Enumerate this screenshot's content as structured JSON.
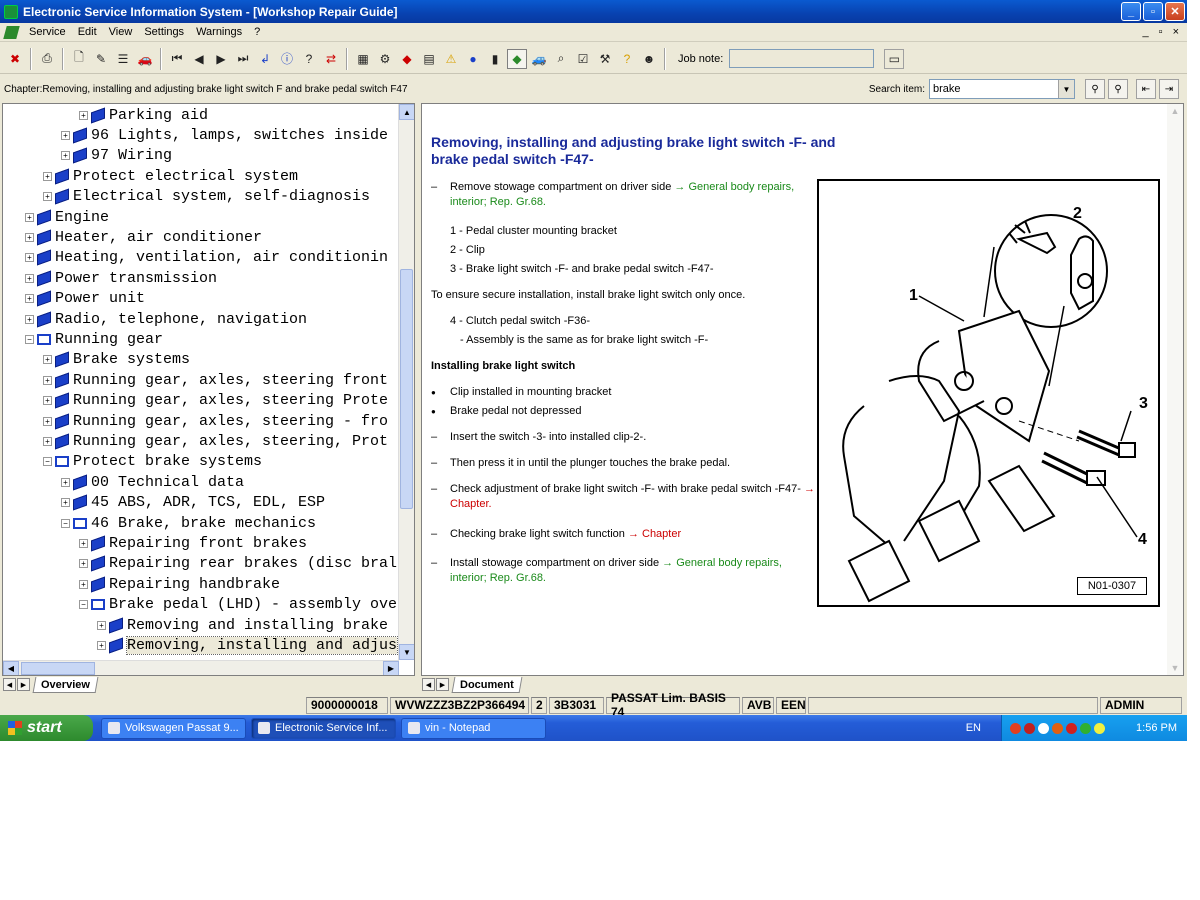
{
  "window": {
    "title": "Electronic Service Information System - [Workshop Repair Guide]",
    "minimize": "_",
    "maximize": "▫",
    "close": "✕"
  },
  "menu": {
    "items": [
      "Service",
      "Edit",
      "View",
      "Settings",
      "Warnings",
      "?"
    ],
    "child_controls": [
      "_",
      "▫",
      "×"
    ]
  },
  "toolbar": {
    "job_note_label": "Job note:",
    "job_note_value": ""
  },
  "chapter_bar": {
    "chapter": "Chapter:Removing, installing and adjusting  brake light switch F  and  brake pedal switch F47",
    "search_label": "Search item:",
    "search_value": "brake"
  },
  "tree": {
    "nodes": [
      {
        "label": "Parking aid",
        "level": 4,
        "icon": "closed-book-icon",
        "expander": "+"
      },
      {
        "label": "96 Lights, lamps, switches inside",
        "level": 3,
        "icon": "closed-book-icon",
        "expander": "+"
      },
      {
        "label": "97 Wiring",
        "level": 3,
        "icon": "closed-book-icon",
        "expander": "+"
      },
      {
        "label": "Protect electrical system",
        "level": 2,
        "icon": "closed-book-icon",
        "expander": "+"
      },
      {
        "label": "Electrical system, self-diagnosis",
        "level": 2,
        "icon": "closed-book-icon",
        "expander": "+"
      },
      {
        "label": "Engine",
        "level": 1,
        "icon": "closed-book-icon",
        "expander": "+"
      },
      {
        "label": "Heater, air conditioner",
        "level": 1,
        "icon": "closed-book-icon",
        "expander": "+"
      },
      {
        "label": "Heating, ventilation, air conditionin",
        "level": 1,
        "icon": "closed-book-icon",
        "expander": "+"
      },
      {
        "label": "Power transmission",
        "level": 1,
        "icon": "closed-book-icon",
        "expander": "+"
      },
      {
        "label": "Power unit",
        "level": 1,
        "icon": "closed-book-icon",
        "expander": "+"
      },
      {
        "label": "Radio, telephone, navigation",
        "level": 1,
        "icon": "closed-book-icon",
        "expander": "+"
      },
      {
        "label": "Running gear",
        "level": 1,
        "icon": "open-book-icon",
        "expander": "−"
      },
      {
        "label": "Brake systems",
        "level": 2,
        "icon": "closed-book-icon",
        "expander": "+"
      },
      {
        "label": "Running gear, axles, steering front",
        "level": 2,
        "icon": "closed-book-icon",
        "expander": "+"
      },
      {
        "label": "Running gear, axles, steering Prote",
        "level": 2,
        "icon": "closed-book-icon",
        "expander": "+"
      },
      {
        "label": "Running gear, axles, steering - fro",
        "level": 2,
        "icon": "closed-book-icon",
        "expander": "+"
      },
      {
        "label": "Running gear, axles, steering, Prot",
        "level": 2,
        "icon": "closed-book-icon",
        "expander": "+"
      },
      {
        "label": "Protect brake systems",
        "level": 2,
        "icon": "open-book-icon",
        "expander": "−"
      },
      {
        "label": "00 Technical data",
        "level": 3,
        "icon": "closed-book-icon",
        "expander": "+"
      },
      {
        "label": "45 ABS, ADR, TCS, EDL, ESP",
        "level": 3,
        "icon": "closed-book-icon",
        "expander": "+"
      },
      {
        "label": "46 Brake, brake mechanics",
        "level": 3,
        "icon": "open-book-icon",
        "expander": "−"
      },
      {
        "label": "Repairing front brakes",
        "level": 4,
        "icon": "closed-book-icon",
        "expander": "+"
      },
      {
        "label": "Repairing rear brakes (disc bral",
        "level": 4,
        "icon": "closed-book-icon",
        "expander": "+"
      },
      {
        "label": "Repairing handbrake",
        "level": 4,
        "icon": "closed-book-icon",
        "expander": "+"
      },
      {
        "label": "Brake pedal (LHD) - assembly ove",
        "level": 4,
        "icon": "open-book-icon",
        "expander": "−"
      },
      {
        "label": "Removing and installing brake",
        "level": 5,
        "icon": "closed-book-icon",
        "expander": "+"
      },
      {
        "label": "Removing, installing and adjus",
        "level": 5,
        "icon": "closed-book-icon",
        "expander": "+",
        "selected": true
      }
    ]
  },
  "left_tab": "Overview",
  "right_tab": "Document",
  "document": {
    "title": "Removing, installing and adjusting brake light switch -F- and brake pedal switch -F47-",
    "paragraphs": [
      {
        "mark": "–",
        "text": "Remove stowage compartment on driver side ",
        "link": "→ General body repairs, interior; Rep. Gr.68.",
        "link_color": "green"
      },
      {
        "mark": "",
        "text": "1 - Pedal cluster mounting bracket"
      },
      {
        "mark": "",
        "text": "2 - Clip"
      },
      {
        "mark": "",
        "text": "3 - Brake light switch -F- and brake pedal switch -F47-"
      },
      {
        "mark": "",
        "text": "To ensure secure installation, install brake light switch only once.",
        "flush": true
      },
      {
        "mark": "",
        "text": "4 - Clutch pedal switch -F36-"
      },
      {
        "mark": "",
        "text": "- Assembly is the same as for brake light switch -F-",
        "indent": true
      },
      {
        "mark": "",
        "text": "Installing brake light switch",
        "flush": true,
        "bold": true
      },
      {
        "mark": "●",
        "text": "Clip installed in mounting bracket"
      },
      {
        "mark": "●",
        "text": "Brake pedal not depressed"
      },
      {
        "mark": "–",
        "text": "Insert the switch -3- into installed clip-2-."
      },
      {
        "mark": "–",
        "text": "Then press it in until the plunger touches the brake pedal."
      },
      {
        "mark": "–",
        "text": "Check adjustment of brake light switch -F- with brake pedal switch -F47- ",
        "link": "→ Chapter.",
        "link_color": "red"
      },
      {
        "mark": "–",
        "text": "Checking brake light switch function ",
        "link": "→ Chapter",
        "link_color": "red"
      },
      {
        "mark": "–",
        "text": "Install stowage compartment on driver side ",
        "link": "→ General body repairs, interior; Rep. Gr.68.",
        "link_color": "green"
      }
    ],
    "figure": {
      "callouts": [
        "1",
        "2",
        "3",
        "4"
      ],
      "label": "N01-0307"
    }
  },
  "status": {
    "cells": [
      "9000000018",
      "WVWZZZ3BZ2P366494",
      "2",
      "3B3031",
      "PASSAT Lim. BASIS 74",
      "AVB",
      "EEN",
      "",
      "ADMIN"
    ]
  },
  "taskbar": {
    "start": "start",
    "tasks": [
      {
        "label": "Volkswagen Passat 9...",
        "active": false
      },
      {
        "label": "Electronic Service Inf...",
        "active": true
      },
      {
        "label": "vin - Notepad",
        "active": false
      }
    ],
    "language": "EN",
    "clock": "1:56 PM"
  },
  "colors": {
    "title_blue": "#1a2a9a",
    "link_green": "#1a8a1a",
    "link_red": "#cc0000",
    "book_blue": "#1a3fc8"
  }
}
